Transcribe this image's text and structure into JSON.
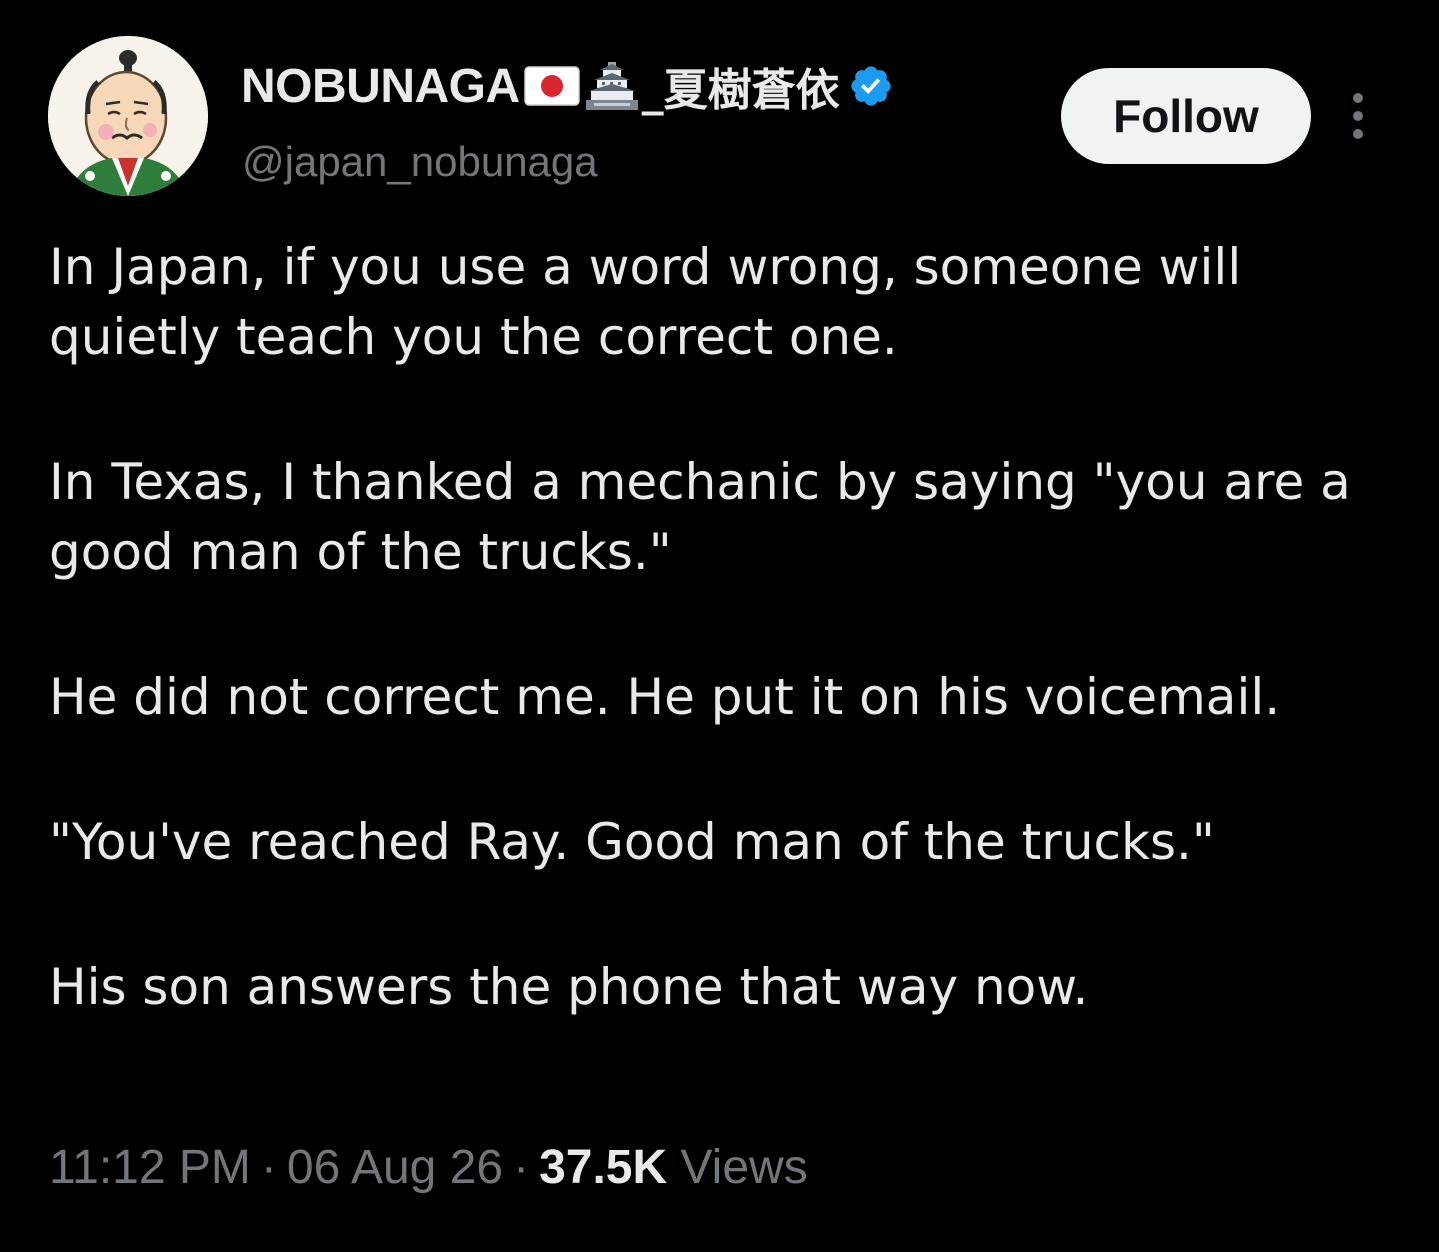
{
  "author": {
    "display_name": "NOBUNAGA",
    "name_suffix": "_夏樹蒼依",
    "handle": "@japan_nobunaga",
    "verified_color": "#1d9bf0",
    "icons": [
      "japan-flag-icon",
      "castle-icon",
      "verified-badge-icon"
    ]
  },
  "actions": {
    "follow_label": "Follow",
    "more_icon": "more-vertical-icon"
  },
  "tweet": {
    "paragraphs": [
      "In Japan, if you use a word wrong, someone will quietly teach you the correct one.",
      "In Texas, I thanked a mechanic by saying \"you are a good man of the trucks.\"",
      "He did not correct me. He put it on his voicemail.",
      "\"You've reached Ray. Good man of the trucks.\"",
      "His son answers the phone that way now."
    ]
  },
  "meta": {
    "time": "11:12 PM",
    "separator": "·",
    "date": "06 Aug 26",
    "views_count": "37.5K",
    "views_label": "Views"
  },
  "colors": {
    "background": "#000000",
    "text": "#e7e9ea",
    "secondary_text": "#71767b",
    "follow_bg": "#eff3f4"
  }
}
